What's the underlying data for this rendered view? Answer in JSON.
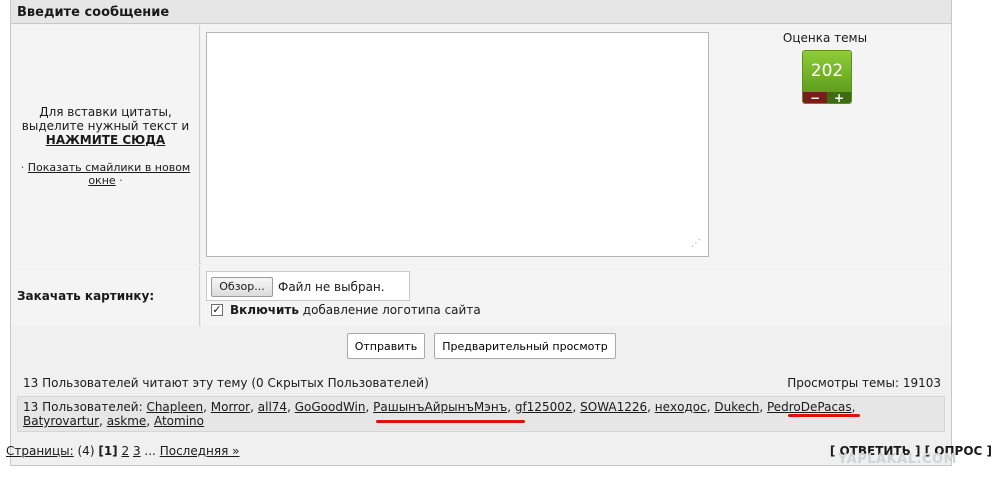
{
  "header": {
    "title": "Введите сообщение"
  },
  "left_panel": {
    "quote_line1": "Для вставки цитаты,",
    "quote_line2": "выделите нужный текст и",
    "quote_link": "НАЖМИТЕ СЮДА",
    "smiles_prefix": "·",
    "smiles_link": "Показать смайлики в новом окне",
    "smiles_suffix": "·"
  },
  "message": {
    "value": "",
    "placeholder": ""
  },
  "rating": {
    "label": "Оценка темы",
    "value": "202",
    "minus": "−",
    "plus": "+"
  },
  "upload": {
    "label": "Закачать картинку:",
    "browse_label": "Обзор...",
    "no_file": "Файл не выбран.",
    "checkbox_mark": "✓",
    "checkbox_bold": "Включить",
    "checkbox_rest": "добавление логотипа сайта"
  },
  "buttons": {
    "send": "Отправить",
    "preview": "Предварительный просмотр"
  },
  "readers": {
    "summary": "13 Пользователей читают эту тему (0 Скрытых Пользователей)",
    "views": "Просмотры темы: 19103",
    "users_prefix": "13 Пользователей:",
    "users": [
      "Chapleen",
      "Morror",
      "all74",
      "GoGoodWin",
      "РашынъАйрынъМэнъ",
      "gf125002",
      "SOWA1226",
      "неходос",
      "Dukech",
      "PedroDePacas",
      "Batyrovartur",
      "askme",
      "Atomino"
    ]
  },
  "pagination": {
    "label": "Страницы:",
    "count": "(4)",
    "current": "[1]",
    "pages": [
      "2",
      "3"
    ],
    "ellipsis": "...",
    "last": "Последняя »"
  },
  "actions": {
    "reply": "[ ОТВЕТИТЬ ]",
    "poll": "[ ОПРОС ]"
  },
  "watermark": "YAPLAKAL.COM",
  "colors": {
    "highlight": "#e01010",
    "rating_green": "#6fae26",
    "rating_minus": "#7a1c1c"
  }
}
